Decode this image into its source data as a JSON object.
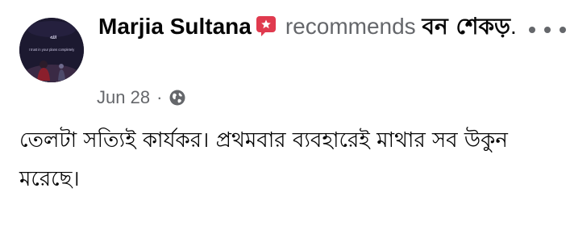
{
  "post": {
    "author": "Marjia Sultana",
    "action_text": "recommends",
    "page_name": "বন শেকড়",
    "page_suffix": ".",
    "date": "Jun 28",
    "separator": "·",
    "privacy_icon": "globe-icon",
    "badge_icon": "recommend-star-icon",
    "more_icon": "more-options-icon",
    "body": "তেলটা সত্যিই কার্যকর। প্রথমবার ব্যবহারেই মাথার সব উকুন মরেছে।"
  },
  "avatar": {
    "caption": "I trust in your plans completely"
  },
  "colors": {
    "text_primary": "#050505",
    "text_secondary": "#65676b",
    "badge_red": "#e03a4e"
  }
}
